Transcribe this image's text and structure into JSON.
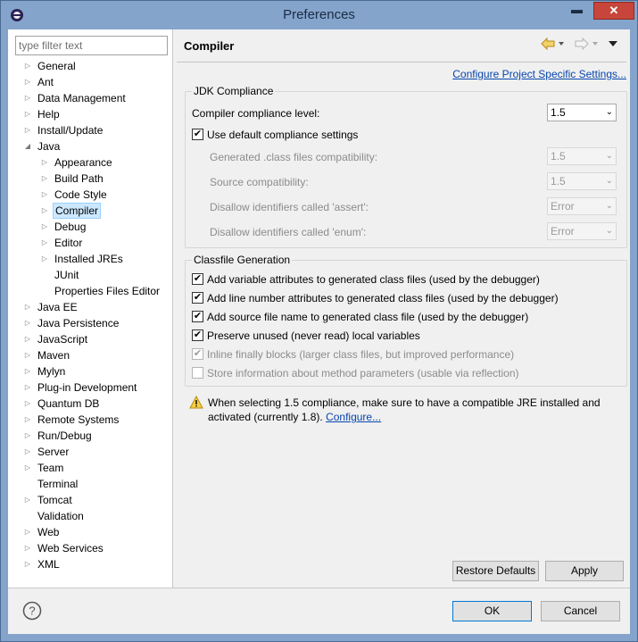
{
  "window": {
    "title": "Preferences",
    "min_label": "▬",
    "max_label": "▢",
    "close_label": "✕"
  },
  "filter": {
    "placeholder": "type filter text"
  },
  "tree": {
    "general": "General",
    "ant": "Ant",
    "data_management": "Data Management",
    "help": "Help",
    "install_update": "Install/Update",
    "java": "Java",
    "java_children": {
      "appearance": "Appearance",
      "build_path": "Build Path",
      "code_style": "Code Style",
      "compiler": "Compiler",
      "debug": "Debug",
      "editor": "Editor",
      "installed_jres": "Installed JREs",
      "junit": "JUnit",
      "properties_files_editor": "Properties Files Editor"
    },
    "java_ee": "Java EE",
    "java_persistence": "Java Persistence",
    "javascript": "JavaScript",
    "maven": "Maven",
    "mylyn": "Mylyn",
    "plugin_development": "Plug-in Development",
    "quantum_db": "Quantum DB",
    "remote_systems": "Remote Systems",
    "run_debug": "Run/Debug",
    "server": "Server",
    "team": "Team",
    "terminal": "Terminal",
    "tomcat": "Tomcat",
    "validation": "Validation",
    "web": "Web",
    "web_services": "Web Services",
    "xml": "XML"
  },
  "page": {
    "title": "Compiler",
    "configure_link": "Configure Project Specific Settings...",
    "jdk_group": "JDK Compliance",
    "compliance_label": "Compiler compliance level:",
    "compliance_value": "1.5",
    "use_default": "Use default compliance settings",
    "generated_label": "Generated .class files compatibility:",
    "generated_value": "1.5",
    "source_label": "Source compatibility:",
    "source_value": "1.5",
    "assert_label": "Disallow identifiers called 'assert':",
    "assert_value": "Error",
    "enum_label": "Disallow identifiers called 'enum':",
    "enum_value": "Error",
    "classfile_group": "Classfile Generation",
    "cb_variable": "Add variable attributes to generated class files (used by the debugger)",
    "cb_line": "Add line number attributes to generated class files (used by the debugger)",
    "cb_source": "Add source file name to generated class file (used by the debugger)",
    "cb_preserve": "Preserve unused (never read) local variables",
    "cb_inline": "Inline finally blocks (larger class files, but improved performance)",
    "cb_store": "Store information about method parameters (usable via reflection)",
    "warning_text_1": "When selecting 1.5 compliance, make sure to have a compatible JRE installed and",
    "warning_text_2": "activated (currently 1.8).",
    "warning_link": "Configure...",
    "restore_defaults": "Restore Defaults",
    "apply": "Apply"
  },
  "footer": {
    "ok": "OK",
    "cancel": "Cancel"
  },
  "colors": {
    "selection": "#cce8ff",
    "link": "#0645ad",
    "title_bar": "#84a4cc",
    "close": "#c7453a"
  }
}
